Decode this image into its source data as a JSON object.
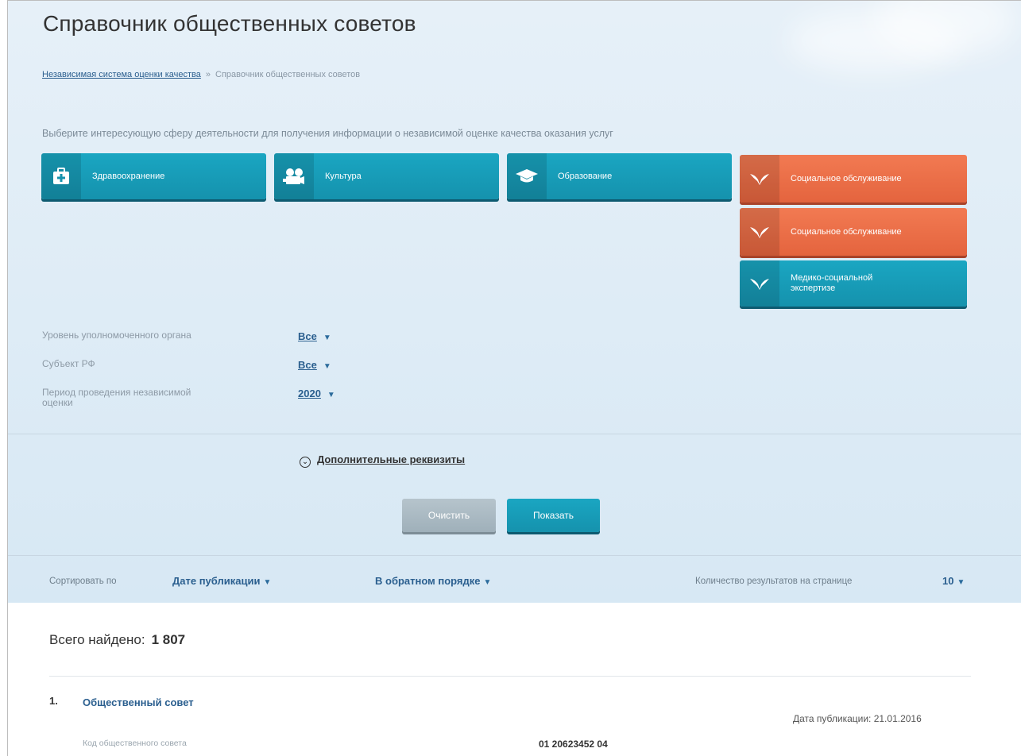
{
  "page": {
    "title": "Справочник общественных советов"
  },
  "breadcrumb": {
    "link": "Независимая система оценки качества",
    "separator": "»",
    "current": "Справочник общественных советов"
  },
  "intro": "Выберите интересующую сферу деятельности для получения информации о независимой оценке качества оказания услуг",
  "spheres": {
    "health": {
      "label": "Здравоохранение",
      "icon": "medkit-icon"
    },
    "culture": {
      "label": "Культура",
      "icon": "film-camera-icon"
    },
    "education": {
      "label": "Образование",
      "icon": "graduation-cap-icon"
    },
    "social1": {
      "label": "Социальное обслуживание",
      "icon": "hands-icon"
    },
    "social2": {
      "label": "Социальное обслуживание",
      "icon": "hands-icon"
    },
    "medsocial": {
      "label": "Медико-социальной экспертизе",
      "icon": "hands-icon"
    }
  },
  "colors": {
    "teal": "#1592ad",
    "orange": "#e4643e",
    "link": "#2b5f8f"
  },
  "filters": {
    "level": {
      "label": "Уровень уполномоченного органа",
      "value": "Все"
    },
    "subject": {
      "label": "Субъект РФ",
      "value": "Все"
    },
    "period": {
      "label": "Период проведения независимой оценки",
      "value": "2020"
    }
  },
  "extra_link": "Дополнительные реквизиты",
  "buttons": {
    "clear": "Очистить",
    "show": "Показать"
  },
  "sort": {
    "label": "Сортировать по",
    "field": "Дате публикации",
    "order": "В обратном порядке",
    "per_page_label": "Количество результатов на странице",
    "per_page": "10"
  },
  "results": {
    "total_label": "Всего найдено:",
    "total": "1 807",
    "items": [
      {
        "num": "1.",
        "title": "Общественный совет",
        "date": "Дата публикации: 21.01.2016",
        "code_label": "Код общественного совета",
        "code": "01 20623452 04"
      }
    ]
  }
}
